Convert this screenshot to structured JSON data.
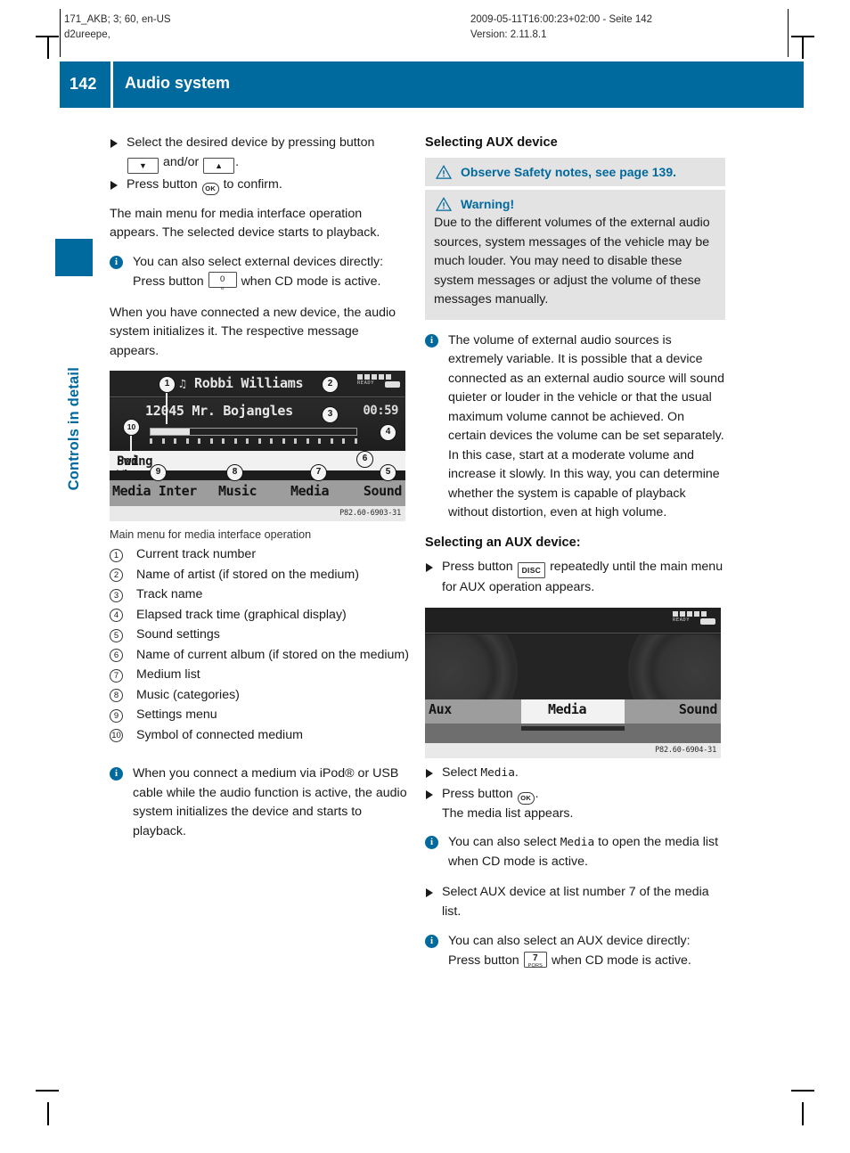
{
  "print_header": {
    "left_line1": "171_AKB; 3; 60, en-US",
    "left_line2": "d2ureepe,",
    "right_line1": "2009-05-11T16:00:23+02:00 - Seite 142",
    "right_line2": "Version: 2.11.8.1"
  },
  "page": {
    "number": "142",
    "title": "Audio system",
    "chapter_tab": "Controls in detail",
    "accent_color": "#00699e"
  },
  "left_column": {
    "steps_1": [
      "Select the desired device by pressing button",
      "and/or"
    ],
    "step1_suffix": ".",
    "key_down": "▼",
    "key_up": "▲",
    "step2_pre": "Press button",
    "step2_post": "to confirm.",
    "ok_key": "OK",
    "para_1": "The main menu for media interface operation appears. The selected device starts to playback.",
    "note_1_pre": "You can also select external devices directly: Press button",
    "note_1_post": "when CD mode is active.",
    "note_1_key_top": "0",
    "note_1_key_bottom": "␣",
    "para_2": "When you have connected a new device, the audio system initializes it. The respective message appears.",
    "figure_1": {
      "artist": "Robbi Williams",
      "track_number": "12045",
      "track_name": "Mr. Bojangles",
      "elapsed": "00:59",
      "album": "Swing When You're Winning",
      "album_prefix": "Pod",
      "ready_label": "READY",
      "menu": [
        "Media Inter",
        "Music",
        "Media",
        "Sound"
      ],
      "credit": "P82.60-6903-31",
      "callouts": [
        "1",
        "2",
        "3",
        "4",
        "5",
        "6",
        "7",
        "8",
        "9",
        "10"
      ]
    },
    "figure_1_caption": "Main menu for media interface operation",
    "legend": [
      {
        "num": "1",
        "text": "Current track number"
      },
      {
        "num": "2",
        "text": "Name of artist (if stored on the medium)"
      },
      {
        "num": "3",
        "text": "Track name"
      },
      {
        "num": "4",
        "text": "Elapsed track time (graphical display)"
      },
      {
        "num": "5",
        "text": "Sound settings"
      },
      {
        "num": "6",
        "text": "Name of current album (if stored on the medium)"
      },
      {
        "num": "7",
        "text": "Medium list"
      },
      {
        "num": "8",
        "text": "Music (categories)"
      },
      {
        "num": "9",
        "text": "Settings menu"
      },
      {
        "num": "10",
        "text": "Symbol of connected medium"
      }
    ],
    "note_2": "When you connect a medium via iPod® or USB cable while the audio function is active, the audio system initializes the device and starts to playback."
  },
  "right_column": {
    "heading_1": "Selecting AUX device",
    "safety_box": "Observe Safety notes, see page 139.",
    "warning_title": "Warning!",
    "warning_body": "Due to the different volumes of the external audio sources, system messages of the vehicle may be much louder. You may need to disable these system messages or adjust the volume of these messages manually.",
    "note_1": "The volume of external audio sources is extremely variable. It is possible that a device connected as an external audio source will sound quieter or louder in the vehicle or that the usual maximum volume cannot be achieved. On certain devices the volume can be set separately. In this case, start at a moderate volume and increase it slowly. In this way, you can determine whether the system is capable of playback without distortion, even at high volume.",
    "heading_2": "Selecting an AUX device:",
    "step_disc_pre": "Press button",
    "step_disc_post": "repeatedly until the main menu for AUX operation appears.",
    "disc_key": "DISC",
    "figure_2": {
      "ready_label": "READY",
      "menu": [
        "Aux",
        "Media",
        "Sound"
      ],
      "credit": "P82.60-6904-31"
    },
    "step_select_pre": "Select",
    "step_select_mono": "Media",
    "step_select_post": ".",
    "step_press_pre": "Press button",
    "step_press_post": ".",
    "ok_key": "OK",
    "step_press_sub": "The media list appears.",
    "note_2_pre": "You can also select",
    "note_2_mono": "Media",
    "note_2_post": "to open the media list when CD mode is active.",
    "step_aux_list": "Select AUX device at list number 7 of the media list.",
    "note_3_pre": "You can also select an AUX device directly: Press button",
    "note_3_post": "when CD mode is active.",
    "note_3_key_top": "7",
    "note_3_key_bottom": "PQRS"
  }
}
